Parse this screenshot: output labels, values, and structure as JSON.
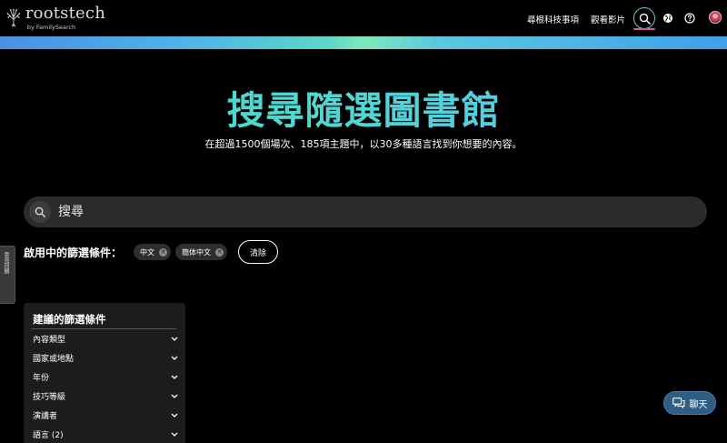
{
  "header": {
    "logo_word": "roots",
    "logo_word_rest": "tech",
    "logo_sub": "by FamilySearch",
    "nav_links": [
      "尋根科技事項",
      "觀看影片"
    ],
    "icons": [
      "search-icon",
      "globe-icon",
      "help-icon",
      "avatar"
    ]
  },
  "hero": {
    "title": "搜尋隨選圖書館",
    "subtitle": "在超過1500個場次、185項主題中，以30多種語言找到你想要的內容。"
  },
  "search": {
    "placeholder": "搜尋"
  },
  "active_filters": {
    "label": "啟用中的篩選條件：",
    "chips": [
      "中文",
      "簡体中文"
    ],
    "clear_label": "清除"
  },
  "side_tab": {
    "label": "意見回饋"
  },
  "suggested_filters": {
    "title": "建議的篩選條件",
    "items": [
      "內容類型",
      "國家或地點",
      "年份",
      "技巧等級",
      "演講者",
      "語言 (2)"
    ]
  },
  "chat": {
    "label": "聊天"
  },
  "colors": {
    "accent_teal": "#3ad6c4",
    "search_ring": "#6cc6d8",
    "active_underline": "#e04fa0",
    "chat_bg": "#2f5d84"
  }
}
